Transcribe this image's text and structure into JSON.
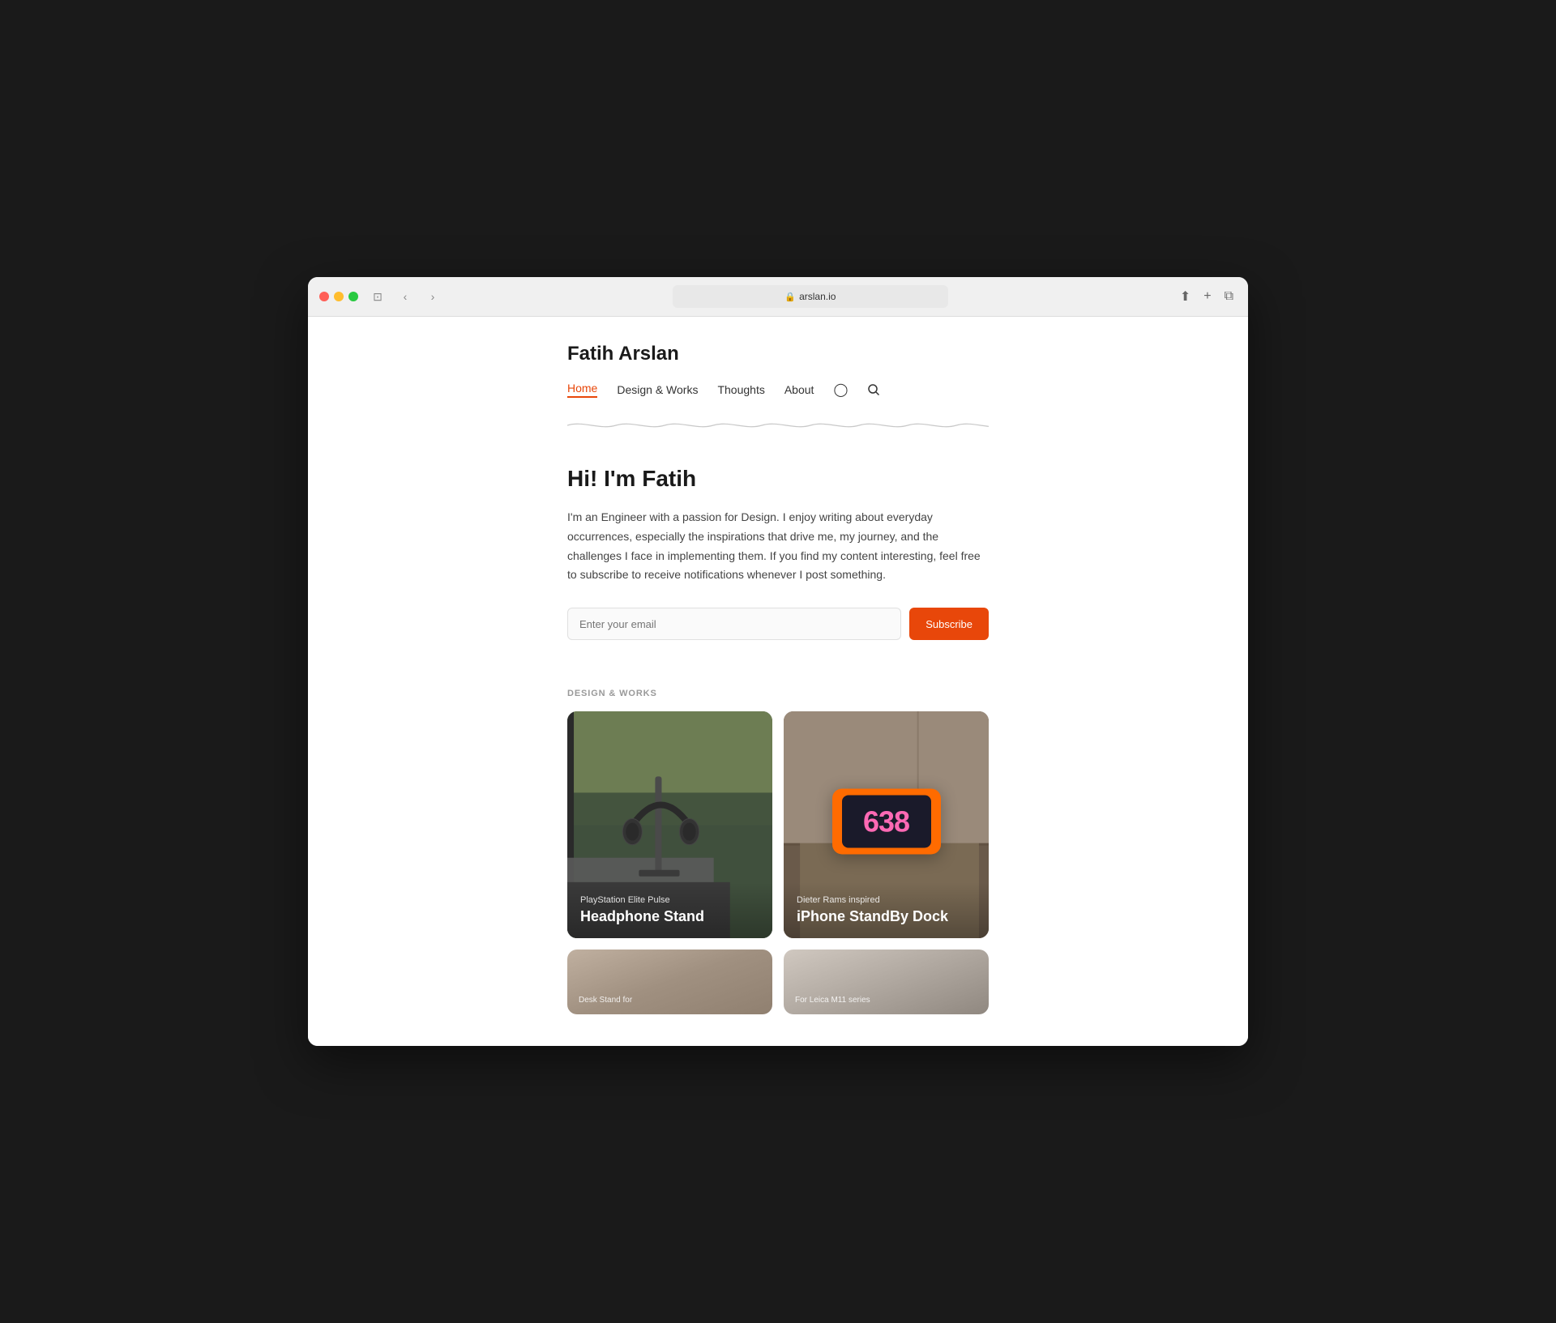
{
  "browser": {
    "url": "arslan.io",
    "back_btn": "‹",
    "forward_btn": "›"
  },
  "site": {
    "title": "Fatih Arslan"
  },
  "nav": {
    "items": [
      {
        "label": "Home",
        "active": true
      },
      {
        "label": "Design & Works",
        "active": false
      },
      {
        "label": "Thoughts",
        "active": false
      },
      {
        "label": "About",
        "active": false
      }
    ]
  },
  "hero": {
    "greeting": "Hi! I'm Fatih",
    "bio": "I'm an Engineer with a passion for Design. I enjoy writing about everyday occurrences, especially the inspirations that drive me, my journey, and the challenges I face in implementing them. If you find my content interesting, feel free to subscribe to receive notifications whenever I post something.",
    "email_placeholder": "Enter your email",
    "subscribe_label": "Subscribe"
  },
  "design_works": {
    "section_label": "DESIGN & WORKS",
    "cards": [
      {
        "id": "headphone-stand",
        "subtitle": "PlayStation Elite Pulse",
        "title": "Headphone Stand"
      },
      {
        "id": "iphone-dock",
        "subtitle": "Dieter Rams inspired",
        "title": "iPhone StandBy Dock"
      }
    ],
    "bottom_cards": [
      {
        "id": "desk-stand",
        "subtitle": "Desk Stand for"
      },
      {
        "id": "leica",
        "subtitle": "For Leica M11 series"
      }
    ],
    "clock_time": "638"
  }
}
